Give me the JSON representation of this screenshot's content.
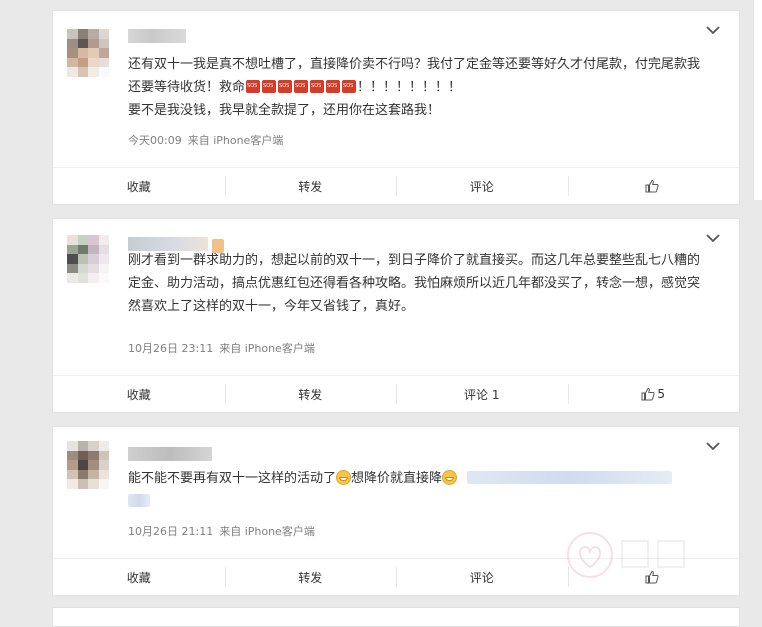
{
  "comments": [
    {
      "content_parts": [
        "还有双十一我是真不想吐槽了，直接降价卖不行吗？我付了定金等还要等好久才付尾款，付完尾款我还要等待收货！救命",
        "！！！！！！！！"
      ],
      "content_line2": "要不是我没钱，我早就全款提了，还用你在这套路我！",
      "sos_count": 7,
      "time": "今天00:09",
      "source": "来自 iPhone客户端",
      "actions": {
        "favorite": "收藏",
        "repost": "转发",
        "comment": "评论",
        "like": ""
      }
    },
    {
      "content": "刚才看到一群求助力的，想起以前的双十一，到日子降价了就直接买。而这几年总要整些乱七八糟的定金、助力活动，搞点优惠红包还得看各种攻略。我怕麻烦所以近几年都没买了，转念一想，感觉突然喜欢上了这样的双十一，今年又省钱了，真好。",
      "time": "10月26日 23:11",
      "source": "来自 iPhone客户端",
      "actions": {
        "favorite": "收藏",
        "repost": "转发",
        "comment": "评论 1",
        "like": "5"
      }
    },
    {
      "content_parts": [
        "能不能不要再有双十一这样的活动了",
        "想降价就直接降"
      ],
      "time": "10月26日 21:11",
      "source": "来自 iPhone客户端",
      "actions": {
        "favorite": "收藏",
        "repost": "转发",
        "comment": "评论",
        "like": ""
      }
    }
  ],
  "icons": {
    "menu": "chevron-down-icon",
    "like": "thumbs-up-icon",
    "emoji": "grin-emoji-icon",
    "sos": "sos-emoji-icon"
  },
  "colors": {
    "text": "#333333",
    "meta": "#808080",
    "background": "#e9e9e9",
    "sos": "#d83a2a"
  }
}
